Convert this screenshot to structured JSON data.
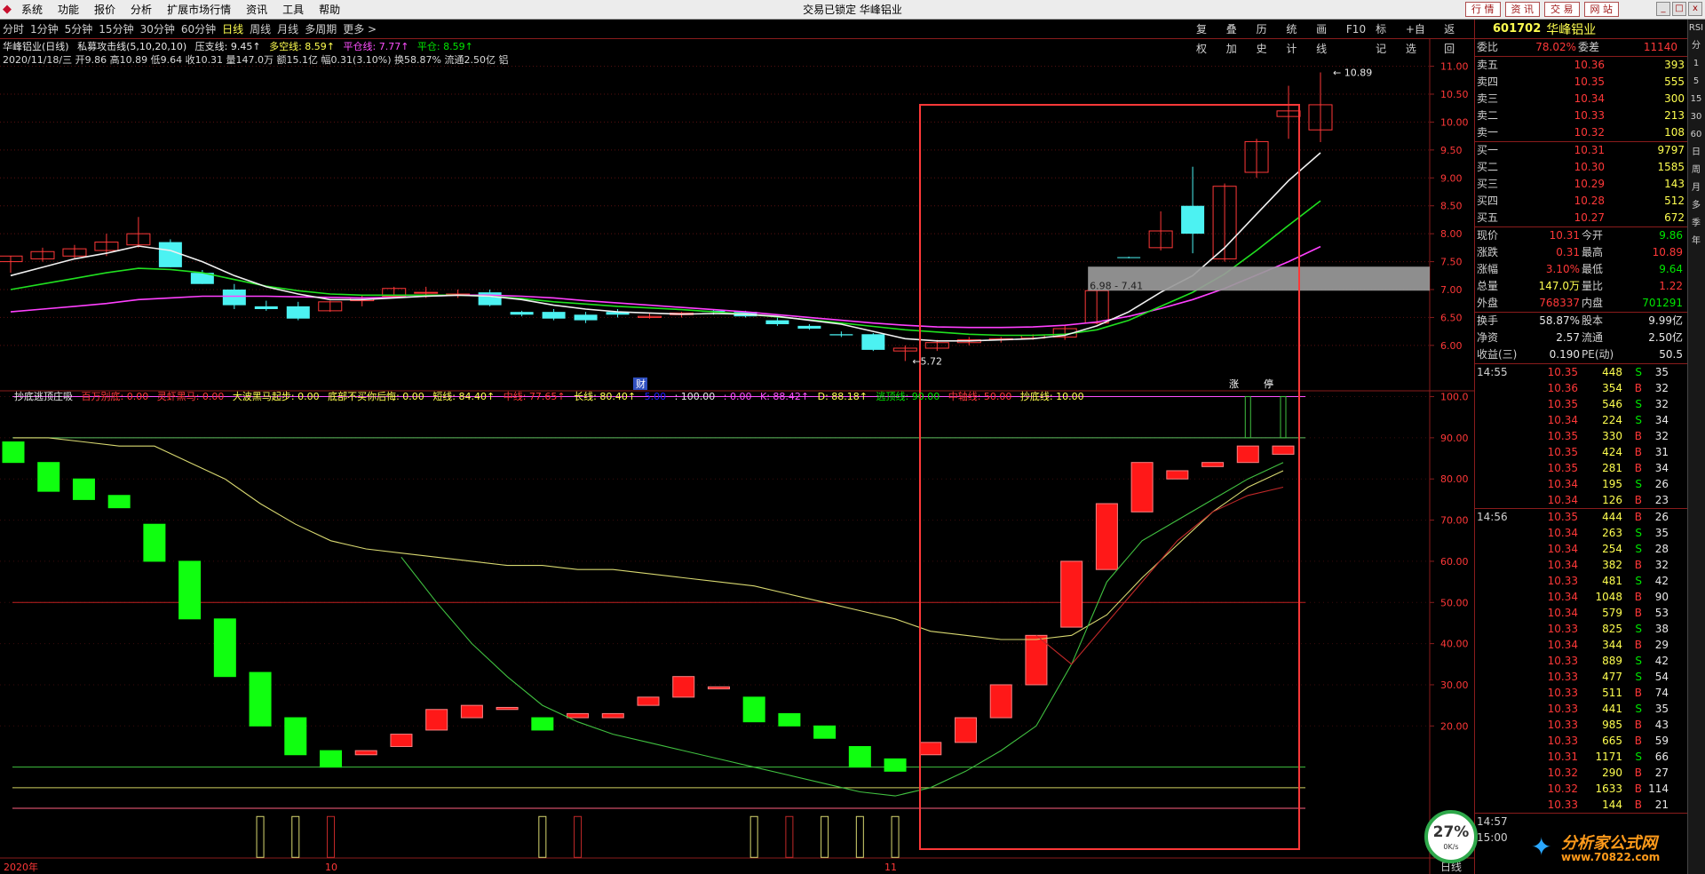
{
  "app": {
    "title": "交易已锁定  华峰铝业",
    "menu": [
      "系统",
      "功能",
      "报价",
      "分析",
      "扩展市场行情",
      "资讯",
      "工具",
      "帮助"
    ],
    "top_buttons": [
      "行 情",
      "资 讯",
      "交 易",
      "网 站"
    ],
    "window_controls": [
      "_",
      "□",
      "x"
    ]
  },
  "periods": {
    "left": [
      "分时",
      "1分钟",
      "5分钟",
      "15分钟",
      "30分钟",
      "60分钟",
      "日线",
      "周线",
      "月线",
      "多周期",
      "更多 >"
    ],
    "active": "日线",
    "right": [
      "复权",
      "叠加",
      "历史",
      "统计",
      "画线",
      "F10",
      "标记",
      "+自选",
      "返回"
    ]
  },
  "main_chart": {
    "header": {
      "name": "华峰铝业(日线)",
      "indicator": "私募攻击线(5,10,20,10)",
      "items": [
        {
          "label": "压支线: 9.45↑",
          "color": "#e8e8e8"
        },
        {
          "label": "多空线: 8.59↑",
          "color": "#ffff50"
        },
        {
          "label": "平仓线: 7.77↑",
          "color": "#ff50ff"
        },
        {
          "label": "平仓: 8.59↑",
          "color": "#00e600"
        }
      ]
    },
    "subheader": "2020/11/18/三 开9.86 高10.89 低9.64 收10.31 量147.0万 额15.1亿 幅0.31(3.10%) 换58.87% 流通2.50亿 铝",
    "price_axis": [
      "11.00",
      "10.50",
      "10.00",
      "9.50",
      "9.00",
      "8.50",
      "8.00",
      "7.50",
      "7.00",
      "6.50",
      "6.00"
    ],
    "annotations": {
      "high": "10.89",
      "low": "5.72",
      "zone": "6.98 - 7.41",
      "tag_cai": "财",
      "tag_zhang": "涨",
      "tag_ting": "停"
    }
  },
  "sub_chart": {
    "header": {
      "name": "抄底逃顶庄吸",
      "items": [
        {
          "label": "百万别底: 0.00",
          "color": "#ff3838"
        },
        {
          "label": "灵虾黑马: 0.00",
          "color": "#ff3838"
        },
        {
          "label": "大波黑马起步: 0.00",
          "color": "#ffff50"
        },
        {
          "label": "底部不买你后悔: 0.00",
          "color": "#ffff50"
        },
        {
          "label": "短线: 84.40↑",
          "color": "#ffff50"
        },
        {
          "label": "中线: 77.65↑",
          "color": "#ff3838"
        },
        {
          "label": "长线: 80.40↑",
          "color": "#ffff50"
        },
        {
          "label": "5.00",
          "color": "#2020ff"
        },
        {
          "label": ": 100.00",
          "color": "#e8e8e8"
        },
        {
          "label": ": 0.00",
          "color": "#ff50ff"
        },
        {
          "label": "K: 88.42↑",
          "color": "#ff50ff"
        },
        {
          "label": "D: 88.18↑",
          "color": "#ffff50"
        },
        {
          "label": "逃顶线: 90.00",
          "color": "#00e600"
        },
        {
          "label": "中轴线: 50.00",
          "color": "#ff3838"
        },
        {
          "label": "抄底线: 10.00",
          "color": "#ffff50"
        }
      ]
    },
    "axis": [
      "100.0",
      "90.00",
      "80.00",
      "70.00",
      "60.00",
      "50.00",
      "40.00",
      "30.00",
      "20.00"
    ]
  },
  "time_axis": {
    "labels": [
      "2020年",
      "10",
      "11"
    ],
    "mode": "日线"
  },
  "quote": {
    "code": "601702",
    "name": "华峰铝业",
    "webi": {
      "label": "委比",
      "value": "78.02%",
      "label2": "委差",
      "value2": "11140"
    },
    "sell": [
      {
        "label": "卖五",
        "price": "10.36",
        "vol": "393"
      },
      {
        "label": "卖四",
        "price": "10.35",
        "vol": "555"
      },
      {
        "label": "卖三",
        "price": "10.34",
        "vol": "300"
      },
      {
        "label": "卖二",
        "price": "10.33",
        "vol": "213"
      },
      {
        "label": "卖一",
        "price": "10.32",
        "vol": "108"
      }
    ],
    "buy": [
      {
        "label": "买一",
        "price": "10.31",
        "vol": "9797"
      },
      {
        "label": "买二",
        "price": "10.30",
        "vol": "1585"
      },
      {
        "label": "买三",
        "price": "10.29",
        "vol": "143"
      },
      {
        "label": "买四",
        "price": "10.28",
        "vol": "512"
      },
      {
        "label": "买五",
        "price": "10.27",
        "vol": "672"
      }
    ],
    "stats": [
      {
        "l": "现价",
        "v": "10.31",
        "vc": "red",
        "l2": "今开",
        "v2": "9.86",
        "v2c": "grn"
      },
      {
        "l": "涨跌",
        "v": "0.31",
        "vc": "red",
        "l2": "最高",
        "v2": "10.89",
        "v2c": "red"
      },
      {
        "l": "涨幅",
        "v": "3.10%",
        "vc": "red",
        "l2": "最低",
        "v2": "9.64",
        "v2c": "grn"
      },
      {
        "l": "总量",
        "v": "147.0万",
        "vc": "yel",
        "l2": "量比",
        "v2": "1.22",
        "v2c": "red"
      },
      {
        "l": "外盘",
        "v": "768337",
        "vc": "red",
        "l2": "内盘",
        "v2": "701291",
        "v2c": "grn"
      }
    ],
    "stats2": [
      {
        "l": "换手",
        "v": "58.87%",
        "vc": "wht",
        "l2": "股本",
        "v2": "9.99亿",
        "v2c": "wht"
      },
      {
        "l": "净资",
        "v": "2.57",
        "vc": "wht",
        "l2": "流通",
        "v2": "2.50亿",
        "v2c": "wht"
      },
      {
        "l": "收益(三)",
        "v": "0.190",
        "vc": "wht",
        "l2": "PE(动)",
        "v2": "50.5",
        "v2c": "wht"
      }
    ],
    "ticks_a": {
      "time": "14:55",
      "rows": [
        [
          "10.35",
          "448",
          "S",
          "35"
        ],
        [
          "10.36",
          "354",
          "B",
          "32"
        ],
        [
          "10.35",
          "546",
          "S",
          "32"
        ],
        [
          "10.34",
          "224",
          "S",
          "34"
        ],
        [
          "10.35",
          "330",
          "B",
          "32"
        ],
        [
          "10.35",
          "424",
          "B",
          "31"
        ],
        [
          "10.35",
          "281",
          "B",
          "34"
        ],
        [
          "10.34",
          "195",
          "S",
          "26"
        ],
        [
          "10.34",
          "126",
          "B",
          "23"
        ]
      ]
    },
    "ticks_b": {
      "time": "14:56",
      "rows": [
        [
          "10.35",
          "444",
          "B",
          "26"
        ],
        [
          "10.34",
          "263",
          "S",
          "35"
        ],
        [
          "10.34",
          "254",
          "S",
          "28"
        ],
        [
          "10.34",
          "382",
          "B",
          "32"
        ],
        [
          "10.33",
          "481",
          "S",
          "42"
        ],
        [
          "10.34",
          "1048",
          "B",
          "90"
        ],
        [
          "10.34",
          "579",
          "B",
          "53"
        ],
        [
          "10.33",
          "825",
          "S",
          "38"
        ],
        [
          "10.34",
          "344",
          "B",
          "29"
        ],
        [
          "10.33",
          "889",
          "S",
          "42"
        ],
        [
          "10.33",
          "477",
          "S",
          "54"
        ],
        [
          "10.33",
          "511",
          "B",
          "74"
        ],
        [
          "10.33",
          "441",
          "S",
          "35"
        ],
        [
          "10.33",
          "985",
          "B",
          "43"
        ],
        [
          "10.33",
          "665",
          "B",
          "59"
        ],
        [
          "10.31",
          "1171",
          "S",
          "66"
        ],
        [
          "10.32",
          "290",
          "B",
          "27"
        ],
        [
          "10.32",
          "1633",
          "B",
          "114"
        ],
        [
          "10.33",
          "144",
          "B",
          "21"
        ]
      ]
    },
    "foot_times": [
      "14:57",
      "15:00"
    ]
  },
  "sidebar": [
    "RSI",
    "分",
    "1",
    "5",
    "15",
    "30",
    "60",
    "日",
    "周",
    "月",
    "多",
    "季",
    "年"
  ],
  "gauge": {
    "pct": "27%",
    "speed": "0K/s"
  },
  "watermark": {
    "t1": "分析家公式网",
    "t2": "www.70822.com"
  },
  "chart_data": {
    "type": "candlestick",
    "main": {
      "ylim": [
        5.6,
        11.2
      ],
      "candles": [
        [
          7.5,
          7.6,
          7.3,
          7.6
        ],
        [
          7.55,
          7.75,
          7.5,
          7.68
        ],
        [
          7.6,
          7.8,
          7.55,
          7.73
        ],
        [
          7.7,
          8.0,
          7.6,
          7.85
        ],
        [
          7.8,
          8.3,
          7.75,
          8.0
        ],
        [
          7.85,
          7.9,
          7.4,
          7.4
        ],
        [
          7.3,
          7.35,
          7.1,
          7.1
        ],
        [
          7.0,
          7.1,
          6.65,
          6.72
        ],
        [
          6.7,
          6.8,
          6.62,
          6.65
        ],
        [
          6.7,
          6.78,
          6.45,
          6.48
        ],
        [
          6.62,
          6.8,
          6.6,
          6.78
        ],
        [
          6.8,
          6.9,
          6.7,
          6.85
        ],
        [
          6.88,
          7.05,
          6.85,
          7.02
        ],
        [
          6.95,
          7.05,
          6.85,
          6.95
        ],
        [
          6.9,
          7.0,
          6.85,
          6.92
        ],
        [
          6.95,
          7.0,
          6.7,
          6.72
        ],
        [
          6.6,
          6.62,
          6.52,
          6.55
        ],
        [
          6.6,
          6.65,
          6.45,
          6.48
        ],
        [
          6.55,
          6.6,
          6.4,
          6.45
        ],
        [
          6.6,
          6.65,
          6.5,
          6.55
        ],
        [
          6.5,
          6.58,
          6.48,
          6.52
        ],
        [
          6.55,
          6.6,
          6.5,
          6.58
        ],
        [
          6.62,
          6.65,
          6.55,
          6.6
        ],
        [
          6.6,
          6.62,
          6.5,
          6.52
        ],
        [
          6.45,
          6.5,
          6.35,
          6.38
        ],
        [
          6.35,
          6.38,
          6.28,
          6.3
        ],
        [
          6.2,
          6.25,
          6.15,
          6.18
        ],
        [
          6.2,
          6.22,
          5.9,
          5.92
        ],
        [
          5.9,
          6.0,
          5.72,
          5.95
        ],
        [
          5.95,
          6.1,
          5.9,
          6.05
        ],
        [
          6.05,
          6.15,
          6.0,
          6.1
        ],
        [
          6.1,
          6.15,
          6.05,
          6.12
        ],
        [
          6.13,
          6.2,
          6.1,
          6.18
        ],
        [
          6.15,
          6.35,
          6.1,
          6.3
        ],
        [
          6.4,
          7.0,
          6.38,
          6.98
        ],
        [
          7.58,
          7.59,
          7.56,
          7.57
        ],
        [
          7.75,
          8.4,
          7.7,
          8.05
        ],
        [
          8.5,
          9.2,
          7.65,
          8.0
        ],
        [
          7.55,
          8.9,
          7.5,
          8.85
        ],
        [
          9.1,
          9.7,
          9.0,
          9.65
        ],
        [
          10.1,
          10.65,
          9.7,
          10.2
        ],
        [
          9.86,
          10.89,
          9.64,
          10.31
        ]
      ],
      "ma_white": [
        7.25,
        7.4,
        7.55,
        7.65,
        7.78,
        7.7,
        7.5,
        7.25,
        7.05,
        6.92,
        6.82,
        6.82,
        6.85,
        6.88,
        6.9,
        6.88,
        6.82,
        6.72,
        6.65,
        6.6,
        6.58,
        6.56,
        6.57,
        6.56,
        6.52,
        6.45,
        6.38,
        6.25,
        6.12,
        6.08,
        6.08,
        6.1,
        6.12,
        6.18,
        6.35,
        6.6,
        6.95,
        7.25,
        7.75,
        8.35,
        8.95,
        9.45
      ],
      "ma_green": [
        7.0,
        7.1,
        7.2,
        7.3,
        7.38,
        7.36,
        7.3,
        7.18,
        7.06,
        6.98,
        6.92,
        6.9,
        6.9,
        6.9,
        6.9,
        6.88,
        6.84,
        6.78,
        6.74,
        6.7,
        6.67,
        6.64,
        6.6,
        6.56,
        6.51,
        6.46,
        6.4,
        6.34,
        6.28,
        6.24,
        6.2,
        6.18,
        6.18,
        6.2,
        6.28,
        6.45,
        6.7,
        6.95,
        7.28,
        7.7,
        8.15,
        8.59
      ],
      "ma_magenta": [
        6.6,
        6.65,
        6.7,
        6.75,
        6.82,
        6.85,
        6.88,
        6.88,
        6.88,
        6.87,
        6.86,
        6.85,
        6.86,
        6.88,
        6.9,
        6.9,
        6.88,
        6.85,
        6.8,
        6.76,
        6.72,
        6.68,
        6.64,
        6.6,
        6.55,
        6.5,
        6.45,
        6.4,
        6.36,
        6.33,
        6.32,
        6.32,
        6.33,
        6.36,
        6.42,
        6.52,
        6.66,
        6.82,
        7.02,
        7.26,
        7.5,
        7.77
      ],
      "zone": [
        6.98,
        7.41
      ]
    },
    "sub": {
      "ylim": [
        0,
        104
      ],
      "bars": [
        [
          89,
          84
        ],
        [
          84,
          77
        ],
        [
          80,
          75
        ],
        [
          76,
          73
        ],
        [
          69,
          60
        ],
        [
          60,
          46
        ],
        [
          46,
          32
        ],
        [
          33,
          20
        ],
        [
          22,
          13
        ],
        [
          14,
          10
        ],
        [
          13,
          14
        ],
        [
          15,
          18
        ],
        [
          19,
          24
        ],
        [
          22,
          25
        ],
        [
          24,
          24.5
        ],
        [
          22,
          19
        ],
        [
          22,
          23
        ],
        [
          22,
          23
        ],
        [
          25,
          27
        ],
        [
          27,
          32
        ],
        [
          29,
          29.5
        ],
        [
          27,
          21
        ],
        [
          23,
          20
        ],
        [
          20,
          17
        ],
        [
          15,
          10
        ],
        [
          12,
          9
        ],
        [
          13,
          16
        ],
        [
          16,
          22
        ],
        [
          22,
          30
        ],
        [
          30,
          42
        ],
        [
          44,
          60
        ],
        [
          58,
          74
        ],
        [
          72,
          84
        ],
        [
          80,
          82
        ],
        [
          83,
          84
        ],
        [
          84,
          88
        ],
        [
          86,
          88
        ]
      ],
      "yellow_line": [
        90,
        90,
        89,
        88,
        88,
        84,
        80,
        74,
        69,
        65,
        63,
        62,
        61,
        60,
        59,
        59,
        58,
        58,
        57,
        56,
        55,
        54,
        52,
        50,
        48,
        46,
        43,
        42,
        41,
        41,
        42,
        47,
        56,
        64,
        72,
        78,
        82
      ],
      "green_line": [
        null,
        null,
        null,
        null,
        null,
        null,
        null,
        null,
        null,
        null,
        null,
        61,
        50,
        40,
        32,
        25,
        21,
        18,
        16,
        14,
        12,
        10,
        8,
        6,
        4,
        3,
        5,
        9,
        14,
        20,
        35,
        55,
        65,
        70,
        75,
        80,
        84
      ],
      "red_line": [
        null,
        null,
        null,
        null,
        null,
        null,
        null,
        null,
        null,
        null,
        null,
        null,
        null,
        null,
        null,
        null,
        null,
        null,
        null,
        null,
        null,
        null,
        null,
        null,
        null,
        null,
        null,
        null,
        null,
        42,
        35,
        45,
        55,
        65,
        72,
        76,
        78
      ],
      "levels": [
        90,
        50,
        10
      ]
    }
  }
}
